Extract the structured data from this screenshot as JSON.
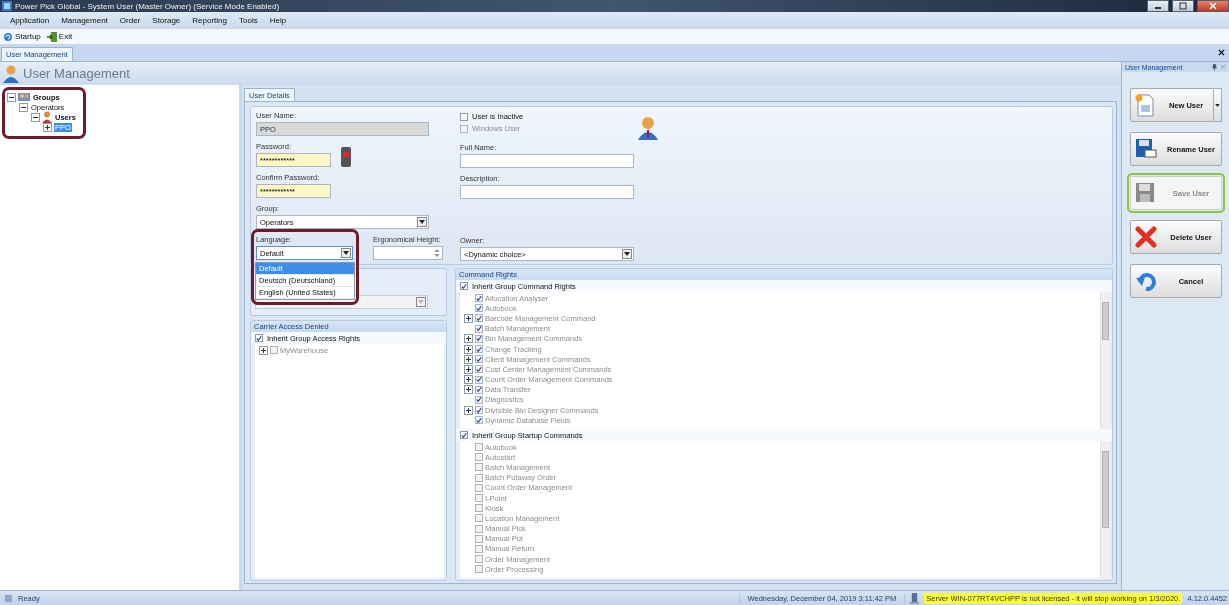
{
  "window": {
    "title": "Power Pick Global - System User (Master Owner) (Service Mode Enabled)"
  },
  "menu": [
    "Application",
    "Management",
    "Order",
    "Storage",
    "Reporting",
    "Tools",
    "Help"
  ],
  "toolbar": [
    {
      "label": "Startup",
      "kind": "startup"
    },
    {
      "label": "Exit",
      "kind": "exit"
    }
  ],
  "document_tabs": [
    {
      "label": "User Management",
      "selected": true
    }
  ],
  "page_header": {
    "title": "User Management"
  },
  "tree": {
    "highlighted": true,
    "nodes": [
      {
        "label": "Groups",
        "kind": "root",
        "expanded": true,
        "selected": false,
        "children": [
          {
            "label": "Operators",
            "expanded": true,
            "selected": false,
            "children": [
              {
                "label": "Users",
                "kind": "users",
                "expanded": true,
                "selected": false,
                "children": [
                  {
                    "label": "PPO",
                    "expanded": false,
                    "selected": true
                  }
                ]
              }
            ]
          }
        ]
      }
    ]
  },
  "detail_tabs": [
    {
      "label": "User Details",
      "selected": true
    }
  ],
  "user_details": {
    "user_name": {
      "label": "User Name:",
      "value": "PPO",
      "disabled": true
    },
    "password": {
      "label": "Password:",
      "value": "************"
    },
    "confirm_password": {
      "label": "Confirm Password:",
      "value": "************"
    },
    "group": {
      "label": "Group:",
      "value": "Operators"
    },
    "language": {
      "label": "Language:",
      "value": "Default",
      "expanded": true,
      "highlighted": true,
      "options": [
        {
          "label": "Default",
          "selected": true
        },
        {
          "label": "Deutsch (Deutschland)",
          "selected": false
        },
        {
          "label": "English (United States)",
          "selected": false
        }
      ]
    },
    "ergonomical_height": {
      "label": "Ergonomical Height:"
    },
    "user_is_inactive": {
      "label": "User is Inactive",
      "checked": false,
      "disabled": false
    },
    "windows_user": {
      "label": "Windows User",
      "checked": false,
      "disabled": true
    },
    "full_name": {
      "label": "Full Name:"
    },
    "description": {
      "label": "Description:"
    },
    "owner": {
      "label": "Owner:",
      "value": "<Dynamic choice>"
    }
  },
  "covered_panel": {
    "field": {
      "disabled": true
    }
  },
  "carrier_access_denied": {
    "title": "Carrier Access Denied",
    "inherit": {
      "label": "Inherit Group Access Rights",
      "checked": true
    },
    "items": [
      {
        "label": "MyWarehouse",
        "checked": false,
        "expandable": true
      }
    ]
  },
  "command_rights": {
    "title": "Command Rights",
    "inherit": {
      "label": "Inherit Group Command Rights",
      "checked": true
    },
    "items": [
      {
        "label": "Allocation Analyser",
        "checked": true,
        "expandable": false
      },
      {
        "label": "Autobook",
        "checked": true,
        "expandable": false
      },
      {
        "label": "Barcode Management Command",
        "checked": true,
        "expandable": true
      },
      {
        "label": "Batch Management",
        "checked": true,
        "expandable": false
      },
      {
        "label": "Bin Management Commands",
        "checked": true,
        "expandable": true
      },
      {
        "label": "Change Tracking",
        "checked": true,
        "expandable": true
      },
      {
        "label": "Client Management Commands",
        "checked": true,
        "expandable": true
      },
      {
        "label": "Cost Center Management Commands",
        "checked": true,
        "expandable": true
      },
      {
        "label": "Count Order Management Commands",
        "checked": true,
        "expandable": true
      },
      {
        "label": "Data Transfer",
        "checked": true,
        "expandable": true
      },
      {
        "label": "Diagnostics",
        "checked": true,
        "expandable": false
      },
      {
        "label": "Divisible Bin Designer Commands",
        "checked": true,
        "expandable": true
      },
      {
        "label": "Dynamic Database Fields",
        "checked": true,
        "expandable": false
      }
    ],
    "startup_inherit": {
      "label": "Inherit Group Startup Commands",
      "checked": true
    },
    "startup_items": [
      {
        "label": "Autobook",
        "checked": false
      },
      {
        "label": "Autostart",
        "checked": false
      },
      {
        "label": "Batch Management",
        "checked": false
      },
      {
        "label": "Batch Putaway Order",
        "checked": false
      },
      {
        "label": "Count Order Management",
        "checked": false
      },
      {
        "label": "I-Point",
        "checked": false
      },
      {
        "label": "Kiosk",
        "checked": false
      },
      {
        "label": "Location Management",
        "checked": false
      },
      {
        "label": "Manual Pick",
        "checked": false
      },
      {
        "label": "Manual Put",
        "checked": false
      },
      {
        "label": "Manual Return",
        "checked": false
      },
      {
        "label": "Order Management",
        "checked": false
      },
      {
        "label": "Order Processing",
        "checked": false
      }
    ]
  },
  "side_panel": {
    "title": "User Management",
    "buttons": [
      {
        "label": "New User",
        "kind": "new",
        "disabled": false,
        "highlighted": false,
        "has_menu": true
      },
      {
        "label": "Rename User",
        "kind": "rename",
        "disabled": false,
        "highlighted": false,
        "has_menu": false
      },
      {
        "label": "Save User",
        "kind": "save",
        "disabled": true,
        "highlighted": true,
        "has_menu": false
      },
      {
        "label": "Delete User",
        "kind": "delete",
        "disabled": false,
        "highlighted": false,
        "has_menu": false
      },
      {
        "label": "Cancel",
        "kind": "cancel",
        "disabled": false,
        "highlighted": false,
        "has_menu": false
      }
    ]
  },
  "status_bar": {
    "status": "Ready",
    "datetime": "Wednesday, December 04, 2019 3:11:42 PM",
    "warning": "Server WIN-077RT4VCHPP is not licensed - it will stop working on 1/3/2020.",
    "version": "4.12.0.4452"
  }
}
